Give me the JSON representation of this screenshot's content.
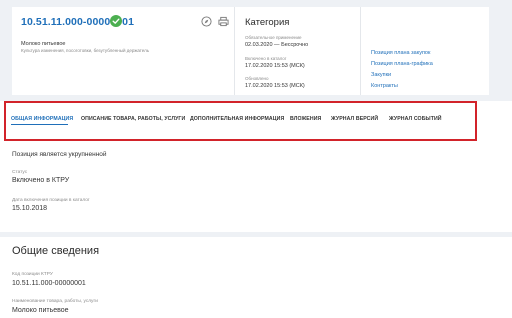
{
  "header": {
    "code": "10.51.11.000-00000001",
    "item_name": "Молоко питьевое",
    "item_desc": "Культура изменения, посоготовки, безутубленный держатель"
  },
  "category": {
    "title": "Категория",
    "date_applied_label": "Обязательное применение",
    "date_applied_value": "02.03.2020 — Бессрочно",
    "included_label": "Включено в каталог",
    "included_value": "17.02.2020 15:53 (МСК)",
    "updated_label": "Обновлено",
    "updated_value": "17.02.2020 15:53 (МСК)"
  },
  "links": {
    "plan_purchases": "Позиция плана закупок",
    "plan_schedule": "Позиция плана-графика",
    "purchases": "Закупки",
    "contracts": "Контракты"
  },
  "tabs": [
    {
      "label": "ОБЩАЯ ИНФОРМАЦИЯ",
      "active": true
    },
    {
      "label": "ОПИСАНИЕ ТОВАРА, РАБОТЫ, УСЛУГИ"
    },
    {
      "label": "ДОПОЛНИТЕЛЬНАЯ ИНФОРМАЦИЯ"
    },
    {
      "label": "ВЛОЖЕНИЯ"
    },
    {
      "label": "ЖУРНАЛ ВЕРСИЙ"
    },
    {
      "label": "ЖУРНАЛ СОБЫТИЙ"
    }
  ],
  "general": {
    "enlarged_note": "Позиция является укрупненной",
    "status_label": "Статус",
    "status_value": "Включено в КТРУ",
    "inclusion_date_label": "Дата включения позиции в каталог",
    "inclusion_date_value": "15.10.2018"
  },
  "overview": {
    "title": "Общие сведения",
    "code_label": "Код позиции КТРУ",
    "code_value": "10.51.11.000-00000001",
    "name_label": "Наименование товара, работы, услуги",
    "name_value": "Молоко питьевое"
  },
  "colors": {
    "accent": "#1f6fb9",
    "success": "#4caf50",
    "highlight": "#d2232a"
  }
}
